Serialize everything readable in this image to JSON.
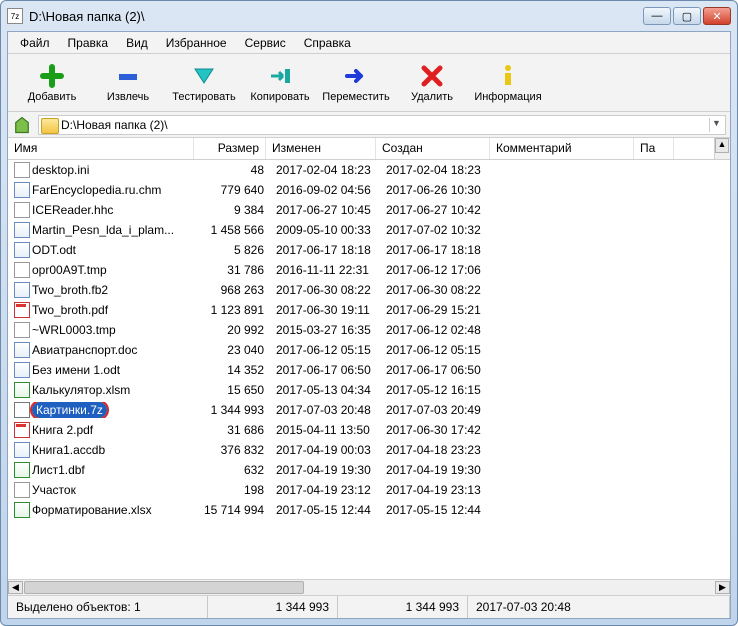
{
  "window": {
    "title": "D:\\Новая папка (2)\\"
  },
  "menu": [
    "Файл",
    "Правка",
    "Вид",
    "Избранное",
    "Сервис",
    "Справка"
  ],
  "toolbar": [
    {
      "label": "Добавить",
      "key": "add"
    },
    {
      "label": "Извлечь",
      "key": "extract"
    },
    {
      "label": "Тестировать",
      "key": "test"
    },
    {
      "label": "Копировать",
      "key": "copy"
    },
    {
      "label": "Переместить",
      "key": "move"
    },
    {
      "label": "Удалить",
      "key": "delete"
    },
    {
      "label": "Информация",
      "key": "info"
    }
  ],
  "path": "D:\\Новая папка (2)\\",
  "columns": {
    "name": "Имя",
    "size": "Размер",
    "modified": "Изменен",
    "created": "Создан",
    "comment": "Комментарий",
    "pag": "Па"
  },
  "files": [
    {
      "name": "desktop.ini",
      "icon": "txt",
      "size": "48",
      "mod": "2017-02-04 18:23",
      "crt": "2017-02-04 18:23"
    },
    {
      "name": "FarEncyclopedia.ru.chm",
      "icon": "doc",
      "size": "779 640",
      "mod": "2016-09-02 04:56",
      "crt": "2017-06-26 10:30"
    },
    {
      "name": "ICEReader.hhc",
      "icon": "txt",
      "size": "9 384",
      "mod": "2017-06-27 10:45",
      "crt": "2017-06-27 10:42"
    },
    {
      "name": "Martin_Pesn_lda_i_plam...",
      "icon": "doc",
      "size": "1 458 566",
      "mod": "2009-05-10 00:33",
      "crt": "2017-07-02 10:32"
    },
    {
      "name": "ODT.odt",
      "icon": "doc",
      "size": "5 826",
      "mod": "2017-06-17 18:18",
      "crt": "2017-06-17 18:18"
    },
    {
      "name": "opr00A9T.tmp",
      "icon": "txt",
      "size": "31 786",
      "mod": "2016-11-11 22:31",
      "crt": "2017-06-12 17:06"
    },
    {
      "name": "Two_broth.fb2",
      "icon": "doc",
      "size": "968 263",
      "mod": "2017-06-30 08:22",
      "crt": "2017-06-30 08:22"
    },
    {
      "name": "Two_broth.pdf",
      "icon": "pdf",
      "size": "1 123 891",
      "mod": "2017-06-30 19:11",
      "crt": "2017-06-29 15:21"
    },
    {
      "name": "~WRL0003.tmp",
      "icon": "txt",
      "size": "20 992",
      "mod": "2015-03-27 16:35",
      "crt": "2017-06-12 02:48"
    },
    {
      "name": "Авиатранспорт.doc",
      "icon": "doc",
      "size": "23 040",
      "mod": "2017-06-12 05:15",
      "crt": "2017-06-12 05:15"
    },
    {
      "name": "Без имени 1.odt",
      "icon": "doc",
      "size": "14 352",
      "mod": "2017-06-17 06:50",
      "crt": "2017-06-17 06:50"
    },
    {
      "name": "Калькулятор.xlsm",
      "icon": "xls",
      "size": "15 650",
      "mod": "2017-05-13 04:34",
      "crt": "2017-05-12 16:15"
    },
    {
      "name": "Картинки.7z",
      "icon": "arc",
      "size": "1 344 993",
      "mod": "2017-07-03 20:48",
      "crt": "2017-07-03 20:49",
      "selected": true
    },
    {
      "name": "Книга 2.pdf",
      "icon": "pdf",
      "size": "31 686",
      "mod": "2015-04-11 13:50",
      "crt": "2017-06-30 17:42"
    },
    {
      "name": "Книга1.accdb",
      "icon": "doc",
      "size": "376 832",
      "mod": "2017-04-19 00:03",
      "crt": "2017-04-18 23:23"
    },
    {
      "name": "Лист1.dbf",
      "icon": "xls",
      "size": "632",
      "mod": "2017-04-19 19:30",
      "crt": "2017-04-19 19:30"
    },
    {
      "name": "Участок",
      "icon": "txt",
      "size": "198",
      "mod": "2017-04-19 23:12",
      "crt": "2017-04-19 23:13"
    },
    {
      "name": "Форматирование.xlsx",
      "icon": "xls",
      "size": "15 714 994",
      "mod": "2017-05-15 12:44",
      "crt": "2017-05-15 12:44"
    }
  ],
  "status": {
    "sel": "Выделено объектов: 1",
    "v1": "1 344 993",
    "v2": "1 344 993",
    "v3": "2017-07-03 20:48"
  }
}
